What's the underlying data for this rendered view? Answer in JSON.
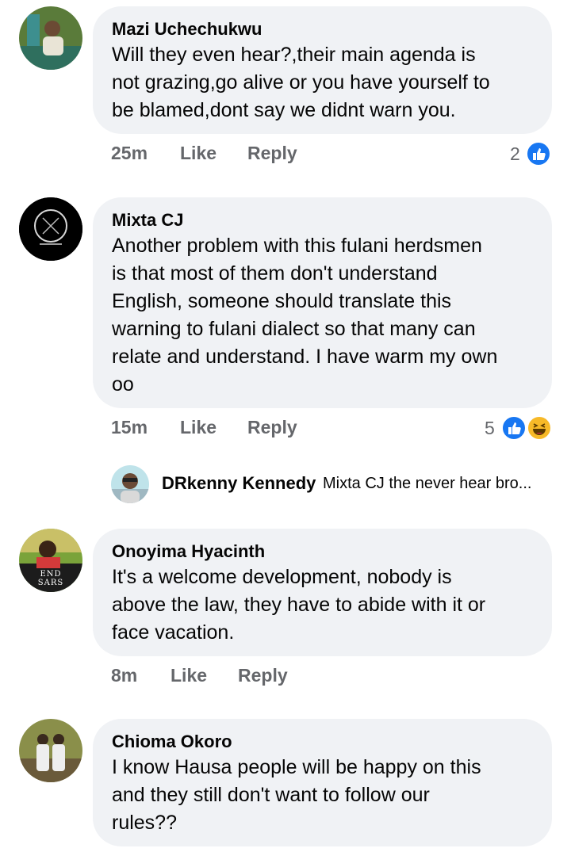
{
  "like_label": "Like",
  "reply_label": "Reply",
  "colors": {
    "bubble": "#f0f2f5",
    "meta": "#65676b",
    "like_blue": "#1877f2",
    "haha_yellow": "#f7b928"
  },
  "comments": [
    {
      "author": "Mazi Uchechukwu",
      "lines": [
        "Will they even hear?,their main agenda is",
        "not grazing,go alive or you have yourself to",
        "be blamed,dont say we didnt warn you."
      ],
      "time": "25m",
      "reaction_count": "2",
      "reactions": [
        "like-icon"
      ]
    },
    {
      "author": "Mixta CJ",
      "lines": [
        "Another problem with this fulani herdsmen",
        "is that most of them don't understand",
        "English, someone should translate this",
        "warning to fulani dialect so that many can",
        "relate and understand. I have warm my own",
        "oo"
      ],
      "time": "15m",
      "reaction_count": "5",
      "reactions": [
        "like-icon",
        "haha-icon"
      ]
    },
    {
      "author": "Onoyima Hyacinth",
      "lines": [
        "It's a welcome development, nobody is",
        "above the law, they have to abide with it or",
        "face vacation."
      ],
      "time": "8m"
    },
    {
      "author": "Chioma Okoro",
      "lines": [
        "I know Hausa people will be happy on this",
        "and they still don't want to follow our",
        "rules??"
      ]
    }
  ],
  "reply": {
    "author": "DRkenny Kennedy",
    "text": "Mixta CJ the never hear bro..."
  },
  "avatar_text": {
    "end_sars": "END SARS"
  }
}
